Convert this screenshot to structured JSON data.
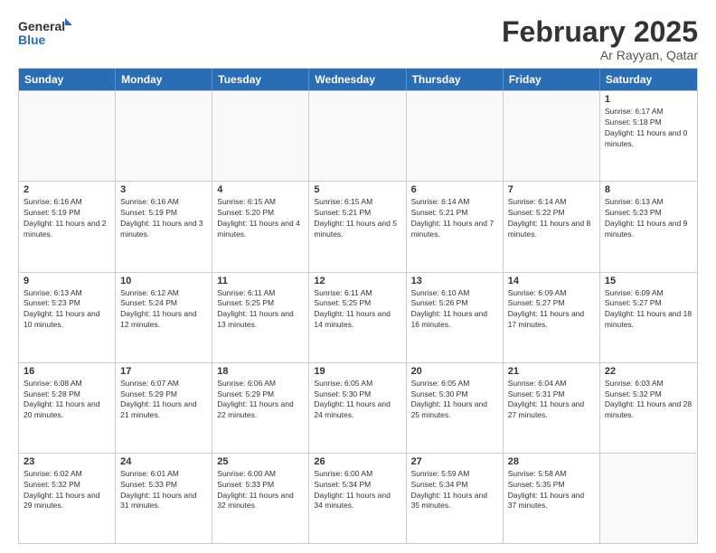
{
  "header": {
    "logo_general": "General",
    "logo_blue": "Blue",
    "title": "February 2025",
    "location": "Ar Rayyan, Qatar"
  },
  "weekdays": [
    "Sunday",
    "Monday",
    "Tuesday",
    "Wednesday",
    "Thursday",
    "Friday",
    "Saturday"
  ],
  "weeks": [
    [
      {
        "day": "",
        "sunrise": "",
        "sunset": "",
        "daylight": ""
      },
      {
        "day": "",
        "sunrise": "",
        "sunset": "",
        "daylight": ""
      },
      {
        "day": "",
        "sunrise": "",
        "sunset": "",
        "daylight": ""
      },
      {
        "day": "",
        "sunrise": "",
        "sunset": "",
        "daylight": ""
      },
      {
        "day": "",
        "sunrise": "",
        "sunset": "",
        "daylight": ""
      },
      {
        "day": "",
        "sunrise": "",
        "sunset": "",
        "daylight": ""
      },
      {
        "day": "1",
        "sunrise": "Sunrise: 6:17 AM",
        "sunset": "Sunset: 5:18 PM",
        "daylight": "Daylight: 11 hours and 0 minutes."
      }
    ],
    [
      {
        "day": "2",
        "sunrise": "Sunrise: 6:16 AM",
        "sunset": "Sunset: 5:19 PM",
        "daylight": "Daylight: 11 hours and 2 minutes."
      },
      {
        "day": "3",
        "sunrise": "Sunrise: 6:16 AM",
        "sunset": "Sunset: 5:19 PM",
        "daylight": "Daylight: 11 hours and 3 minutes."
      },
      {
        "day": "4",
        "sunrise": "Sunrise: 6:15 AM",
        "sunset": "Sunset: 5:20 PM",
        "daylight": "Daylight: 11 hours and 4 minutes."
      },
      {
        "day": "5",
        "sunrise": "Sunrise: 6:15 AM",
        "sunset": "Sunset: 5:21 PM",
        "daylight": "Daylight: 11 hours and 5 minutes."
      },
      {
        "day": "6",
        "sunrise": "Sunrise: 6:14 AM",
        "sunset": "Sunset: 5:21 PM",
        "daylight": "Daylight: 11 hours and 7 minutes."
      },
      {
        "day": "7",
        "sunrise": "Sunrise: 6:14 AM",
        "sunset": "Sunset: 5:22 PM",
        "daylight": "Daylight: 11 hours and 8 minutes."
      },
      {
        "day": "8",
        "sunrise": "Sunrise: 6:13 AM",
        "sunset": "Sunset: 5:23 PM",
        "daylight": "Daylight: 11 hours and 9 minutes."
      }
    ],
    [
      {
        "day": "9",
        "sunrise": "Sunrise: 6:13 AM",
        "sunset": "Sunset: 5:23 PM",
        "daylight": "Daylight: 11 hours and 10 minutes."
      },
      {
        "day": "10",
        "sunrise": "Sunrise: 6:12 AM",
        "sunset": "Sunset: 5:24 PM",
        "daylight": "Daylight: 11 hours and 12 minutes."
      },
      {
        "day": "11",
        "sunrise": "Sunrise: 6:11 AM",
        "sunset": "Sunset: 5:25 PM",
        "daylight": "Daylight: 11 hours and 13 minutes."
      },
      {
        "day": "12",
        "sunrise": "Sunrise: 6:11 AM",
        "sunset": "Sunset: 5:25 PM",
        "daylight": "Daylight: 11 hours and 14 minutes."
      },
      {
        "day": "13",
        "sunrise": "Sunrise: 6:10 AM",
        "sunset": "Sunset: 5:26 PM",
        "daylight": "Daylight: 11 hours and 16 minutes."
      },
      {
        "day": "14",
        "sunrise": "Sunrise: 6:09 AM",
        "sunset": "Sunset: 5:27 PM",
        "daylight": "Daylight: 11 hours and 17 minutes."
      },
      {
        "day": "15",
        "sunrise": "Sunrise: 6:09 AM",
        "sunset": "Sunset: 5:27 PM",
        "daylight": "Daylight: 11 hours and 18 minutes."
      }
    ],
    [
      {
        "day": "16",
        "sunrise": "Sunrise: 6:08 AM",
        "sunset": "Sunset: 5:28 PM",
        "daylight": "Daylight: 11 hours and 20 minutes."
      },
      {
        "day": "17",
        "sunrise": "Sunrise: 6:07 AM",
        "sunset": "Sunset: 5:29 PM",
        "daylight": "Daylight: 11 hours and 21 minutes."
      },
      {
        "day": "18",
        "sunrise": "Sunrise: 6:06 AM",
        "sunset": "Sunset: 5:29 PM",
        "daylight": "Daylight: 11 hours and 22 minutes."
      },
      {
        "day": "19",
        "sunrise": "Sunrise: 6:05 AM",
        "sunset": "Sunset: 5:30 PM",
        "daylight": "Daylight: 11 hours and 24 minutes."
      },
      {
        "day": "20",
        "sunrise": "Sunrise: 6:05 AM",
        "sunset": "Sunset: 5:30 PM",
        "daylight": "Daylight: 11 hours and 25 minutes."
      },
      {
        "day": "21",
        "sunrise": "Sunrise: 6:04 AM",
        "sunset": "Sunset: 5:31 PM",
        "daylight": "Daylight: 11 hours and 27 minutes."
      },
      {
        "day": "22",
        "sunrise": "Sunrise: 6:03 AM",
        "sunset": "Sunset: 5:32 PM",
        "daylight": "Daylight: 11 hours and 28 minutes."
      }
    ],
    [
      {
        "day": "23",
        "sunrise": "Sunrise: 6:02 AM",
        "sunset": "Sunset: 5:32 PM",
        "daylight": "Daylight: 11 hours and 29 minutes."
      },
      {
        "day": "24",
        "sunrise": "Sunrise: 6:01 AM",
        "sunset": "Sunset: 5:33 PM",
        "daylight": "Daylight: 11 hours and 31 minutes."
      },
      {
        "day": "25",
        "sunrise": "Sunrise: 6:00 AM",
        "sunset": "Sunset: 5:33 PM",
        "daylight": "Daylight: 11 hours and 32 minutes."
      },
      {
        "day": "26",
        "sunrise": "Sunrise: 6:00 AM",
        "sunset": "Sunset: 5:34 PM",
        "daylight": "Daylight: 11 hours and 34 minutes."
      },
      {
        "day": "27",
        "sunrise": "Sunrise: 5:59 AM",
        "sunset": "Sunset: 5:34 PM",
        "daylight": "Daylight: 11 hours and 35 minutes."
      },
      {
        "day": "28",
        "sunrise": "Sunrise: 5:58 AM",
        "sunset": "Sunset: 5:35 PM",
        "daylight": "Daylight: 11 hours and 37 minutes."
      },
      {
        "day": "",
        "sunrise": "",
        "sunset": "",
        "daylight": ""
      }
    ]
  ]
}
